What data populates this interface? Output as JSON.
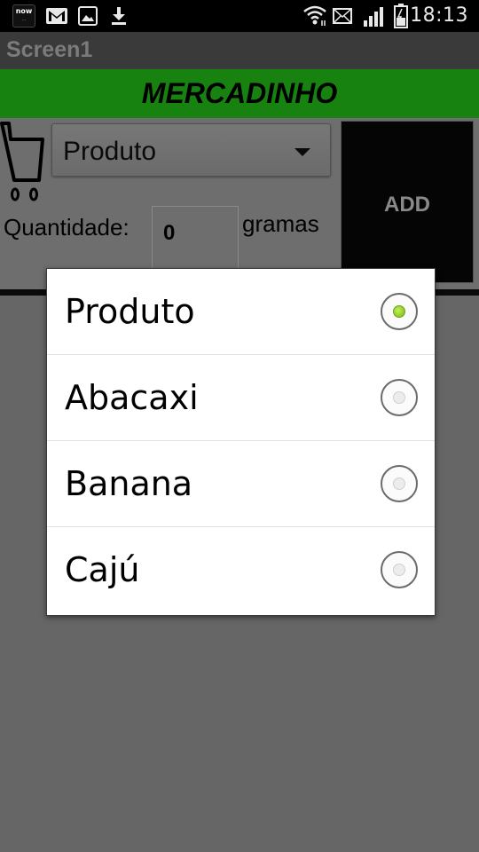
{
  "status_bar": {
    "now_badge": "now",
    "icons": [
      "now-app-icon",
      "gmail-icon",
      "gallery-icon",
      "download-icon",
      "wifi-icon",
      "sms-icon",
      "signal-icon",
      "battery-icon"
    ],
    "time": "18:13"
  },
  "app": {
    "screen_title": "Screen1",
    "header_title": "MERCADINHO",
    "header_color": "#17820f"
  },
  "form": {
    "spinner_selected": "Produto",
    "add_label": "ADD",
    "quantity_label": "Quantidade:",
    "quantity_value": "0",
    "unit_label": "gramas"
  },
  "dialog": {
    "options": [
      {
        "label": "Produto",
        "selected": true
      },
      {
        "label": "Abacaxi",
        "selected": false
      },
      {
        "label": "Banana",
        "selected": false
      },
      {
        "label": "Cajú",
        "selected": false
      }
    ]
  }
}
